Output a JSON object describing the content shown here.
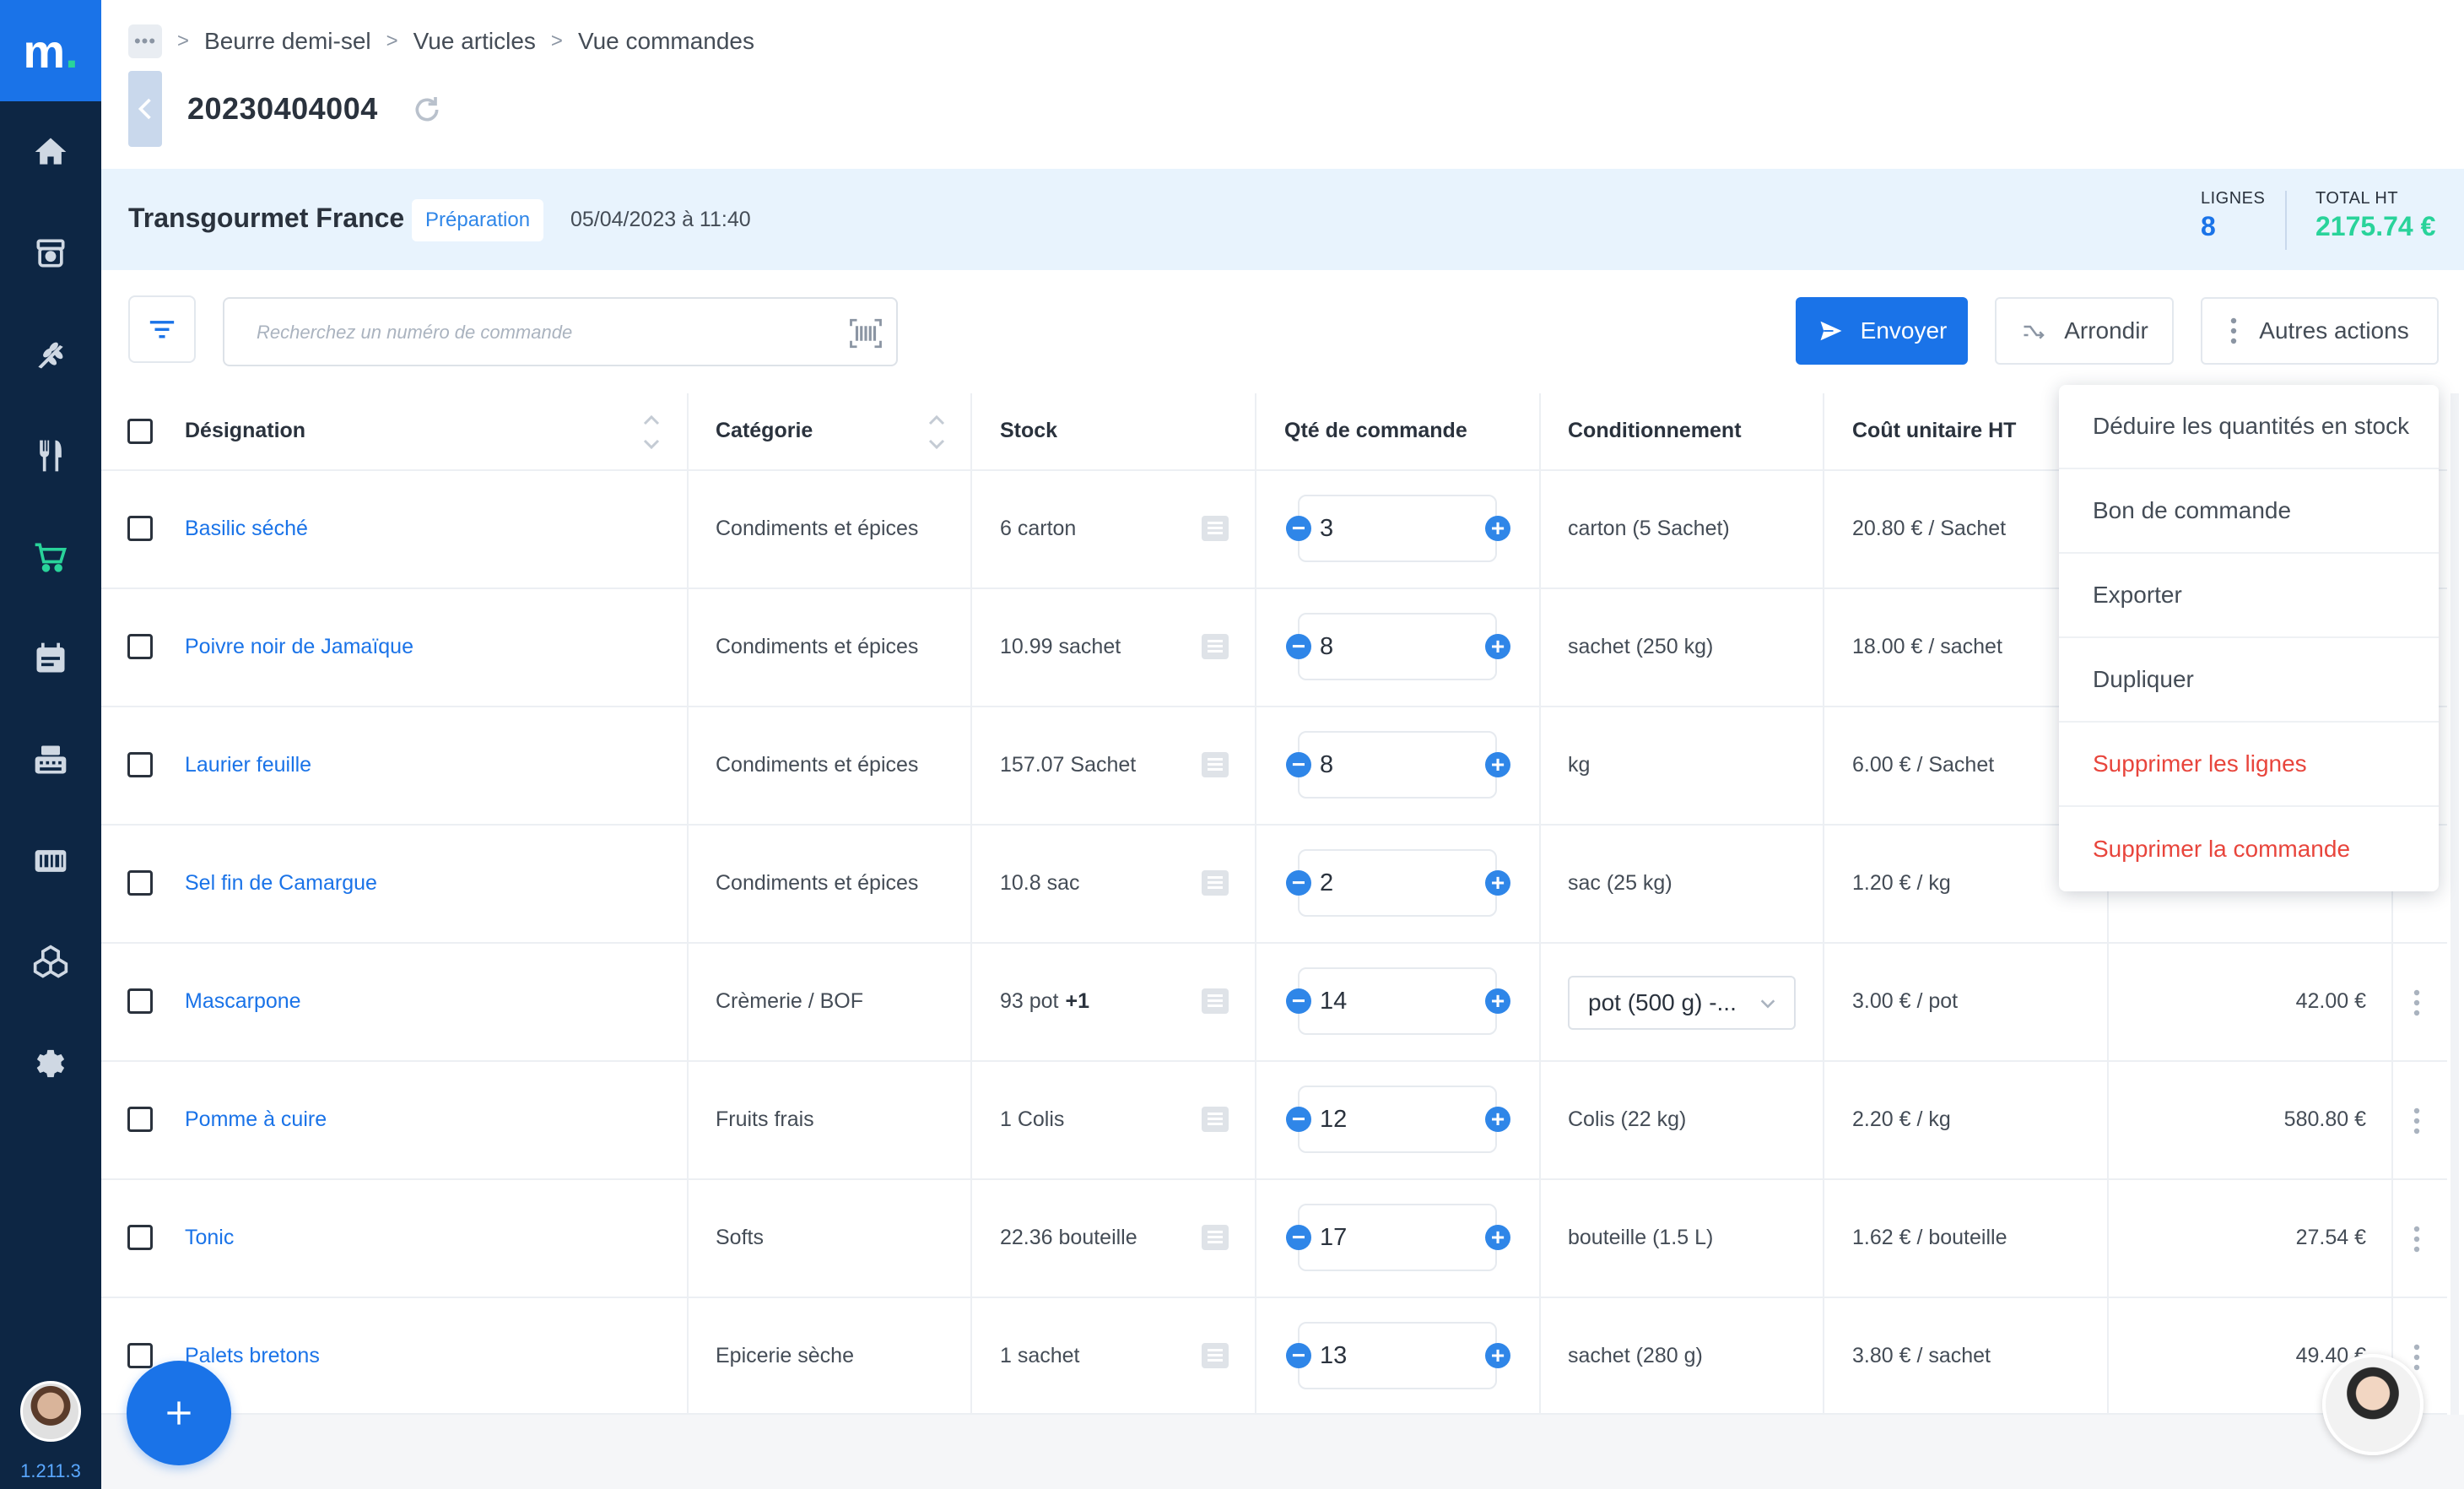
{
  "app": {
    "logo_letter": "m",
    "logo_dot": ".",
    "version": "1.211.3"
  },
  "breadcrumb": {
    "dots": "•••",
    "items": [
      "Beurre demi-sel",
      "Vue articles",
      "Vue commandes"
    ]
  },
  "order": {
    "id": "20230404004",
    "supplier": "Transgourmet France",
    "status": "Préparation",
    "date": "05/04/2023 à 11:40",
    "lines_label": "LIGNES",
    "lines_count": "8",
    "total_label": "TOTAL HT",
    "total_value": "2175.74 €"
  },
  "toolbar": {
    "search_placeholder": "Recherchez un numéro de commande",
    "send_label": "Envoyer",
    "round_label": "Arrondir",
    "more_label": "Autres actions"
  },
  "table": {
    "headers": {
      "designation": "Désignation",
      "category": "Catégorie",
      "stock": "Stock",
      "qty": "Qté de commande",
      "packaging": "Conditionnement",
      "unit_cost": "Coût unitaire HT"
    },
    "rows": [
      {
        "designation": "Basilic séché",
        "category": "Condiments et épices",
        "stock": "6 carton",
        "qty": "3",
        "packaging": "carton (5 Sachet)",
        "unit_cost": "20.80 € / Sachet",
        "total": ""
      },
      {
        "designation": "Poivre noir de Jamaïque",
        "category": "Condiments et épices",
        "stock": "10.99 sachet",
        "qty": "8",
        "packaging": "sachet (250 kg)",
        "unit_cost": "18.00 € / sachet",
        "total": ""
      },
      {
        "designation": "Laurier feuille",
        "category": "Condiments et épices",
        "stock": "157.07 Sachet",
        "qty": "8",
        "packaging": "kg",
        "unit_cost": "6.00 € / Sachet",
        "total": ""
      },
      {
        "designation": "Sel fin de Camargue",
        "category": "Condiments et épices",
        "stock": "10.8 sac",
        "qty": "2",
        "packaging": "sac (25 kg)",
        "unit_cost": "1.20 € / kg",
        "total": ""
      },
      {
        "designation": "Mascarpone",
        "category": "Crèmerie / BOF",
        "stock": "93 pot",
        "stock_extra": "+1",
        "qty": "14",
        "packaging": "pot (500 g) -...",
        "unit_cost": "3.00 € / pot",
        "total": "42.00 €"
      },
      {
        "designation": "Pomme à cuire",
        "category": "Fruits frais",
        "stock": "1 Colis",
        "qty": "12",
        "packaging": "Colis (22 kg)",
        "unit_cost": "2.20 € / kg",
        "total": "580.80 €"
      },
      {
        "designation": "Tonic",
        "category": "Softs",
        "stock": "22.36 bouteille",
        "qty": "17",
        "packaging": "bouteille (1.5 L)",
        "unit_cost": "1.62 € / bouteille",
        "total": "27.54 €"
      },
      {
        "designation": "Palets bretons",
        "category": "Epicerie sèche",
        "stock": "1 sachet",
        "qty": "13",
        "packaging": "sachet (280 g)",
        "unit_cost": "3.80 € / sachet",
        "total": "49.40 €"
      }
    ]
  },
  "menu": {
    "items": [
      "Déduire les quantités en stock",
      "Bon de commande",
      "Exporter",
      "Dupliquer",
      "Supprimer les lignes",
      "Supprimer la commande"
    ]
  },
  "colors": {
    "primary": "#1a73e8",
    "sidebar": "#0d2644",
    "success": "#29d39a",
    "danger": "#e8453c",
    "band": "#e8f3fd"
  },
  "icons": {
    "nav": [
      "home-icon",
      "inventory-icon",
      "ingredients-icon",
      "restaurant-icon",
      "cart-icon",
      "calendar-icon",
      "cash-register-icon",
      "barcode-icon",
      "boxes-icon",
      "gear-icon"
    ]
  }
}
